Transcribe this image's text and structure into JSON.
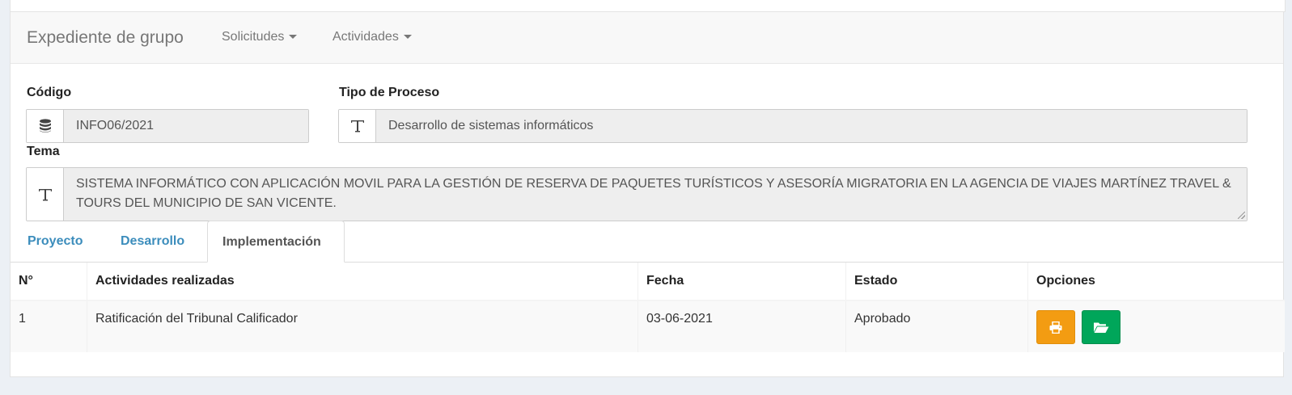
{
  "navbar": {
    "brand": "Expediente de grupo",
    "menus": [
      {
        "label": "Solicitudes"
      },
      {
        "label": "Actividades"
      }
    ]
  },
  "form": {
    "codigo": {
      "label": "Código",
      "value": "INFO06/2021",
      "icon": "database-icon"
    },
    "tipo": {
      "label": "Tipo de Proceso",
      "value": "Desarrollo de sistemas informáticos",
      "icon": "text-icon"
    },
    "tema": {
      "label": "Tema",
      "value": "SISTEMA INFORMÁTICO CON APLICACIÓN MOVIL PARA LA GESTIÓN DE RESERVA DE PAQUETES TURÍSTICOS Y ASESORÍA MIGRATORIA EN LA AGENCIA DE VIAJES MARTÍNEZ TRAVEL & TOURS DEL MUNICIPIO DE SAN VICENTE.",
      "icon": "text-icon"
    }
  },
  "tabs": [
    {
      "label": "Proyecto"
    },
    {
      "label": "Desarrollo"
    },
    {
      "label": "Implementación",
      "active": true
    }
  ],
  "table": {
    "headers": [
      "N°",
      "Actividades realizadas",
      "Fecha",
      "Estado",
      "Opciones"
    ],
    "rows": [
      {
        "num": "1",
        "actividad": "Ratificación del Tribunal Calificador",
        "fecha": "03-06-2021",
        "estado": "Aprobado"
      }
    ]
  },
  "colors": {
    "print_button": "#f39c12",
    "open_button": "#00a65a",
    "tab_link": "#3c8dbc"
  }
}
